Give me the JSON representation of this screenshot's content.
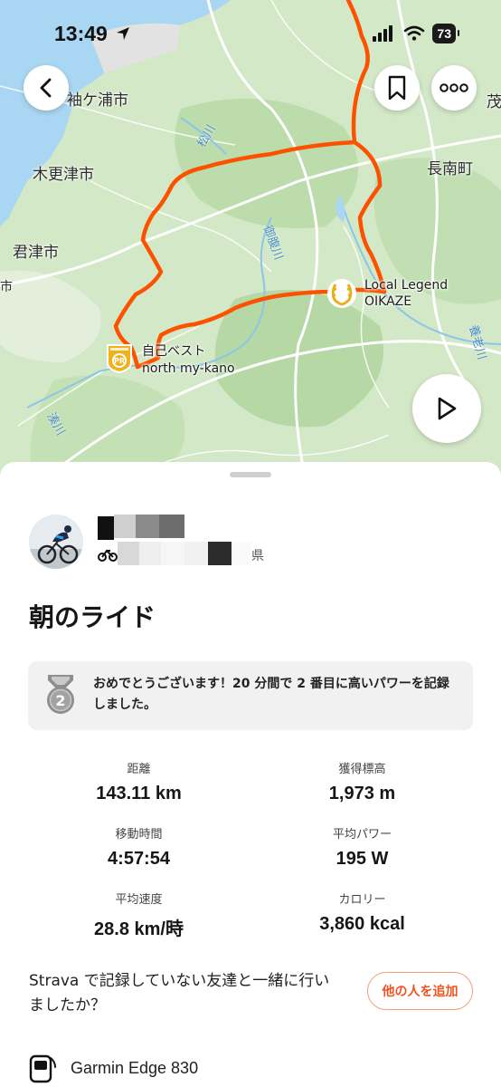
{
  "status_bar": {
    "time": "13:49",
    "battery": "73"
  },
  "map": {
    "places": [
      "袖ケ浦市",
      "木更津市",
      "君津市",
      "長南町",
      "茂",
      "市"
    ],
    "rivers": [
      "松川",
      "御腹川",
      "小櫃川",
      "湊川",
      "養老川"
    ],
    "local_legend": {
      "title": "Local Legend",
      "segment": "OIKAZE"
    },
    "personal_best": {
      "title": "自己ベスト",
      "segment": "north my-kano",
      "badge": "PR"
    }
  },
  "activity": {
    "athlete_location_suffix": "県",
    "title": "朝のライド",
    "achievement": {
      "medal_rank": "2",
      "text": "おめでとうございます！20 分間で 2 番目に高いパワーを記録しました。"
    },
    "stats": [
      {
        "label": "距離",
        "value": "143.11 km"
      },
      {
        "label": "獲得標高",
        "value": "1,973 m"
      },
      {
        "label": "移動時間",
        "value": "4:57:54"
      },
      {
        "label": "平均パワー",
        "value": "195 W"
      },
      {
        "label": "平均速度",
        "value": "28.8 km/時"
      },
      {
        "label": "カロリー",
        "value": "3,860 kcal"
      }
    ],
    "friends_prompt": "Strava で記録していない友達と一緒に行いましたか？",
    "add_others_label": "他の人を追加",
    "device": "Garmin Edge 830"
  },
  "colors": {
    "route": "#fc5200",
    "accent_text": "#f0531f",
    "water": "#a9d6f2",
    "land": "#cfe6c4"
  }
}
